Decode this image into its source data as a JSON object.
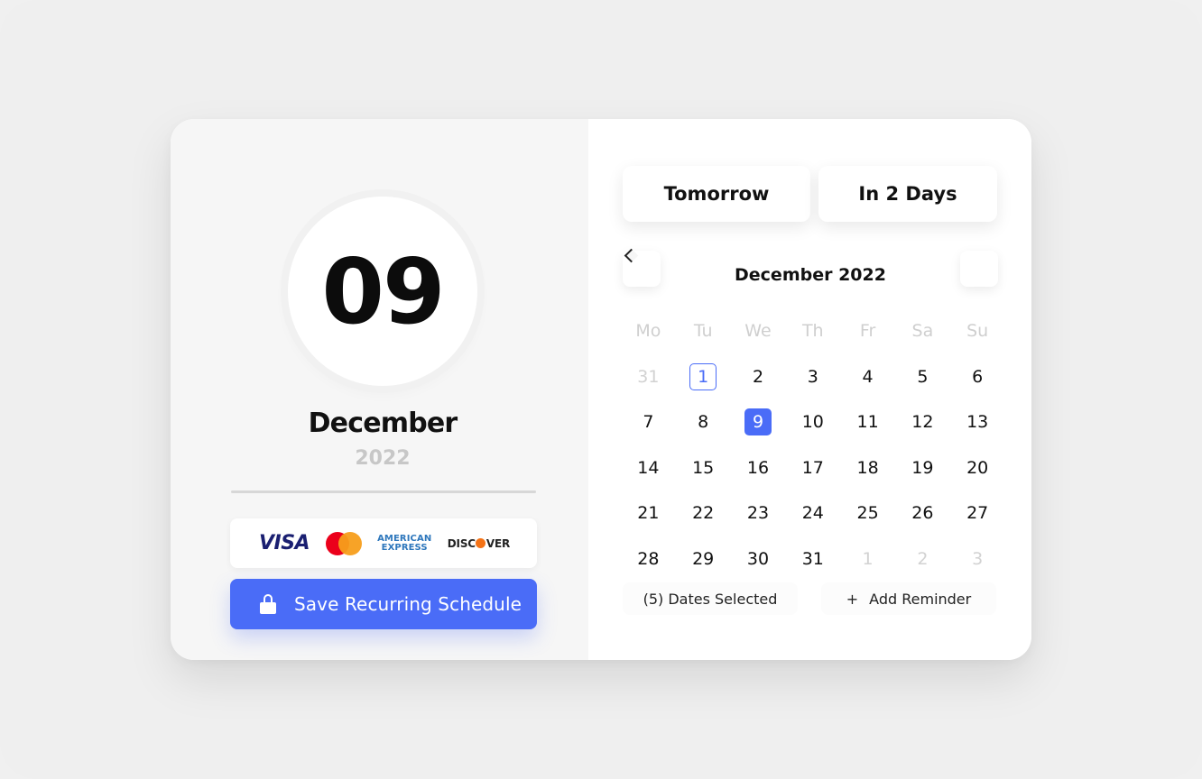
{
  "selected_date": {
    "day": "09",
    "month": "December",
    "year": "2022"
  },
  "payments": {
    "visa": "VISA",
    "amex_line1": "AMERICAN",
    "amex_line2": "EXPRESS",
    "discover_part1": "DISC",
    "discover_part2": "VER"
  },
  "save_button": {
    "label": "Save Recurring Schedule"
  },
  "quick_picks": {
    "tomorrow": "Tomorrow",
    "in_two_days": "In 2 Days"
  },
  "calendar": {
    "title": "December 2022",
    "weekdays": [
      "Mo",
      "Tu",
      "We",
      "Th",
      "Fr",
      "Sa",
      "Su"
    ],
    "weeks": [
      [
        "31",
        "1",
        "2",
        "3",
        "4",
        "5",
        "6"
      ],
      [
        "7",
        "8",
        "9",
        "10",
        "11",
        "12",
        "13"
      ],
      [
        "14",
        "15",
        "16",
        "17",
        "18",
        "19",
        "20"
      ],
      [
        "21",
        "22",
        "23",
        "24",
        "25",
        "26",
        "27"
      ],
      [
        "28",
        "29",
        "30",
        "31",
        "1",
        "2",
        "3"
      ]
    ]
  },
  "footer": {
    "dates_selected": "(5) Dates Selected",
    "add_reminder": "Add Reminder",
    "add_reminder_icon": "+"
  },
  "colors": {
    "accent": "#4a6cf7",
    "muted": "#d2d2d2"
  }
}
